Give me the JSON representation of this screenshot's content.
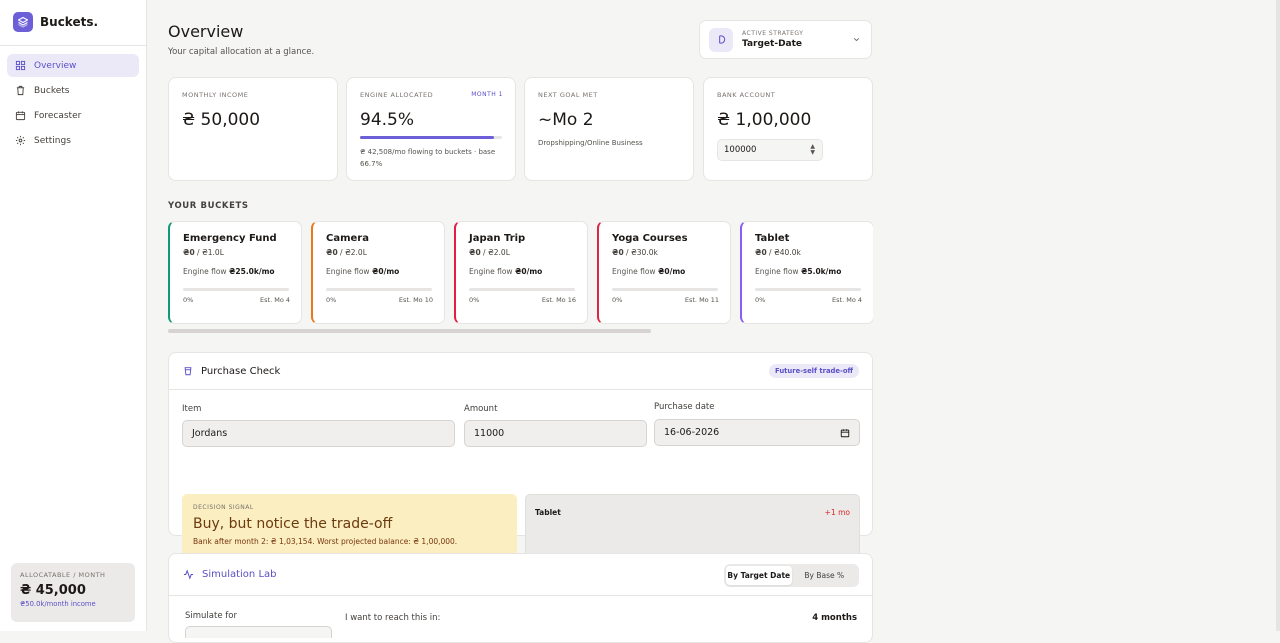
{
  "app": {
    "name": "Buckets."
  },
  "nav": {
    "items": [
      {
        "label": "Overview",
        "icon": "grid-icon",
        "active": true
      },
      {
        "label": "Buckets",
        "icon": "trash-icon",
        "active": false
      },
      {
        "label": "Forecaster",
        "icon": "calendar-icon",
        "active": false
      },
      {
        "label": "Settings",
        "icon": "gear-icon",
        "active": false
      }
    ]
  },
  "allocatable": {
    "label": "Allocatable / Month",
    "value": "₴ 45,000",
    "sub": "₴50.0k/month income"
  },
  "header": {
    "title": "Overview",
    "subtitle": "Your capital allocation at a glance."
  },
  "strategy": {
    "label": "Active Strategy",
    "value": "Target-Date"
  },
  "stats": {
    "income": {
      "label": "Monthly Income",
      "value": "₴ 50,000"
    },
    "engine": {
      "label": "Engine Allocated",
      "badge": "Month 1",
      "value": "94.5%",
      "progress": 0.945,
      "sub": "₴ 42,508/mo flowing to buckets · base 66.7%"
    },
    "goal": {
      "label": "Next Goal Met",
      "value": "~Mo 2",
      "sub": "Dropshipping/Online Business"
    },
    "bank": {
      "label": "Bank Account",
      "value": "₴ 1,00,000",
      "input": "100000"
    }
  },
  "buckets_section": {
    "title": "Your Buckets"
  },
  "buckets": [
    {
      "name": "Emergency Fund",
      "saved": "₴0",
      "target": "₴1.0L",
      "flow_label": "Engine flow",
      "flow": "₴25.0k/mo",
      "pct": "0%",
      "est": "Est. Mo 4",
      "color": "#0f9b76"
    },
    {
      "name": "Camera",
      "saved": "₴0",
      "target": "₴2.0L",
      "flow_label": "Engine flow",
      "flow": "₴0/mo",
      "pct": "0%",
      "est": "Est. Mo 10",
      "color": "#ea7a16"
    },
    {
      "name": "Japan Trip",
      "saved": "₴0",
      "target": "₴2.0L",
      "flow_label": "Engine flow",
      "flow": "₴0/mo",
      "pct": "0%",
      "est": "Est. Mo 16",
      "color": "#e11d48"
    },
    {
      "name": "Yoga Courses",
      "saved": "₴0",
      "target": "₴30.0k",
      "flow_label": "Engine flow",
      "flow": "₴0/mo",
      "pct": "0%",
      "est": "Est. Mo 11",
      "color": "#dc2645"
    },
    {
      "name": "Tablet",
      "saved": "₴0",
      "target": "₴40.0k",
      "flow_label": "Engine flow",
      "flow": "₴5.0k/mo",
      "pct": "0%",
      "est": "Est. Mo 4",
      "color": "#8b5cf6"
    }
  ],
  "purchase": {
    "title": "Purchase Check",
    "pill": "Future-self trade-off",
    "item_label": "Item",
    "item_value": "Jordans",
    "amount_label": "Amount",
    "amount_value": "11000",
    "date_label": "Purchase date",
    "date_value": "16-06-2026",
    "signal_label": "Decision Signal",
    "signal_title": "Buy, but notice the trade-off",
    "signal_sub": "Bank after month 2: ₴ 1,03,154. Worst projected balance: ₴ 1,00,000.",
    "impact_name": "Tablet",
    "impact_delta": "+1 mo"
  },
  "simulation": {
    "title": "Simulation Lab",
    "tabs": [
      "By Target Date",
      "By Base %"
    ],
    "simulate_label": "Simulate for",
    "reach_label": "I want to reach this in:",
    "months": "4 months"
  }
}
